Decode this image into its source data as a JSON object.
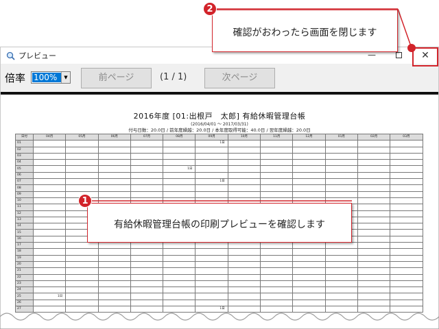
{
  "window": {
    "title": "プレビュー",
    "minimize_label": "—",
    "close_label": "✕"
  },
  "toolbar": {
    "zoom_label": "倍率",
    "zoom_value": "100%",
    "prev_label": "前ページ",
    "page_indicator": "(1 / 1)",
    "next_label": "次ページ"
  },
  "report": {
    "title": "2016年度 [01:出根戸　太郎] 有給休暇管理台帳",
    "period": "(2016/04/01 ～ 2017/03/31)",
    "summary": "付与日数：20.0日 / 前年度繰越：20.0日 / 本年度取得可能：40.0日 / 翌年度繰越：20.0日",
    "grid": {
      "corner": "日付",
      "months": [
        "04月",
        "05月",
        "06月",
        "07月",
        "08月",
        "09月",
        "10月",
        "11月",
        "12月",
        "01月",
        "02月",
        "03月"
      ],
      "days": [
        "01",
        "02",
        "03",
        "04",
        "05",
        "06",
        "07",
        "08",
        "09",
        "10",
        "11",
        "12",
        "13",
        "14",
        "15",
        "16",
        "17",
        "18",
        "19",
        "20",
        "21",
        "22",
        "23",
        "24",
        "25",
        "26",
        "27"
      ],
      "marks": [
        {
          "day": "01",
          "month": "09月",
          "text": "1日"
        },
        {
          "day": "05",
          "month": "08月",
          "text": "1日"
        },
        {
          "day": "07",
          "month": "09月",
          "text": "1日"
        },
        {
          "day": "25",
          "month": "04月",
          "text": "1日"
        },
        {
          "day": "27",
          "month": "09月",
          "text": "1日"
        }
      ]
    }
  },
  "callouts": {
    "one": {
      "number": "1",
      "text": "有給休暇管理台帳の印刷プレビューを確認します"
    },
    "two": {
      "number": "2",
      "text": "確認がおわったら画面を閉じます"
    }
  },
  "colors": {
    "accent": "#d2232a",
    "selection": "#0078d7",
    "grid_header": "#dcdcdc"
  }
}
